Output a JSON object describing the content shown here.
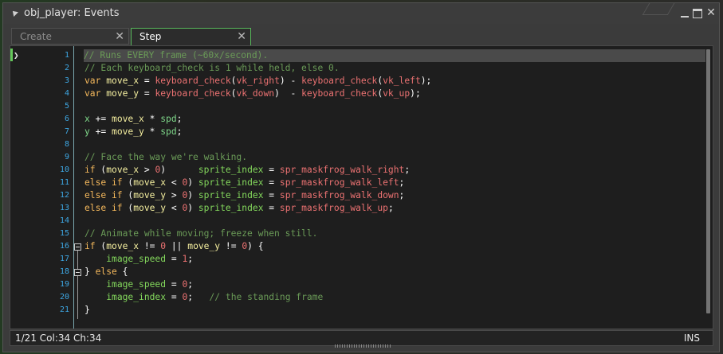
{
  "window": {
    "title": "obj_player: Events"
  },
  "tabs": [
    {
      "label": "Create",
      "active": false
    },
    {
      "label": "Step",
      "active": true
    }
  ],
  "status": {
    "position": "1/21 Col:34 Ch:34",
    "mode": "INS"
  },
  "editor": {
    "line_numbers": [
      "1",
      "2",
      "3",
      "4",
      "5",
      "6",
      "7",
      "8",
      "9",
      "10",
      "11",
      "12",
      "13",
      "14",
      "15",
      "16",
      "17",
      "18",
      "19",
      "20",
      "21"
    ],
    "lines": [
      [
        [
          "c",
          "// Runs EVERY frame (~60x/second)."
        ]
      ],
      [
        [
          "c",
          "// Each keyboard_check is 1 while held, else 0."
        ]
      ],
      [
        [
          "k",
          "var "
        ],
        [
          "v",
          "move_x"
        ],
        [
          "p",
          " = "
        ],
        [
          "f",
          "keyboard_check"
        ],
        [
          "p",
          "("
        ],
        [
          "r",
          "vk_right"
        ],
        [
          "p",
          ") - "
        ],
        [
          "f",
          "keyboard_check"
        ],
        [
          "p",
          "("
        ],
        [
          "r",
          "vk_left"
        ],
        [
          "p",
          ");"
        ]
      ],
      [
        [
          "k",
          "var "
        ],
        [
          "v",
          "move_y"
        ],
        [
          "p",
          " = "
        ],
        [
          "f",
          "keyboard_check"
        ],
        [
          "p",
          "("
        ],
        [
          "r",
          "vk_down"
        ],
        [
          "p",
          ")  - "
        ],
        [
          "f",
          "keyboard_check"
        ],
        [
          "p",
          "("
        ],
        [
          "r",
          "vk_up"
        ],
        [
          "p",
          ");"
        ]
      ],
      [],
      [
        [
          "b",
          "x"
        ],
        [
          "p",
          " += "
        ],
        [
          "v",
          "move_x"
        ],
        [
          "p",
          " * "
        ],
        [
          "b",
          "spd"
        ],
        [
          "p",
          ";"
        ]
      ],
      [
        [
          "b",
          "y"
        ],
        [
          "p",
          " += "
        ],
        [
          "v",
          "move_y"
        ],
        [
          "p",
          " * "
        ],
        [
          "b",
          "spd"
        ],
        [
          "p",
          ";"
        ]
      ],
      [],
      [
        [
          "c",
          "// Face the way we're walking."
        ]
      ],
      [
        [
          "k",
          "if "
        ],
        [
          "p",
          "("
        ],
        [
          "v",
          "move_x"
        ],
        [
          "p",
          " > "
        ],
        [
          "n",
          "0"
        ],
        [
          "p",
          ")      "
        ],
        [
          "g",
          "sprite_index"
        ],
        [
          "p",
          " = "
        ],
        [
          "r",
          "spr_maskfrog_walk_right"
        ],
        [
          "p",
          ";"
        ]
      ],
      [
        [
          "k",
          "else if "
        ],
        [
          "p",
          "("
        ],
        [
          "v",
          "move_x"
        ],
        [
          "p",
          " < "
        ],
        [
          "n",
          "0"
        ],
        [
          "p",
          ") "
        ],
        [
          "g",
          "sprite_index"
        ],
        [
          "p",
          " = "
        ],
        [
          "r",
          "spr_maskfrog_walk_left"
        ],
        [
          "p",
          ";"
        ]
      ],
      [
        [
          "k",
          "else if "
        ],
        [
          "p",
          "("
        ],
        [
          "v",
          "move_y"
        ],
        [
          "p",
          " > "
        ],
        [
          "n",
          "0"
        ],
        [
          "p",
          ") "
        ],
        [
          "g",
          "sprite_index"
        ],
        [
          "p",
          " = "
        ],
        [
          "r",
          "spr_maskfrog_walk_down"
        ],
        [
          "p",
          ";"
        ]
      ],
      [
        [
          "k",
          "else if "
        ],
        [
          "p",
          "("
        ],
        [
          "v",
          "move_y"
        ],
        [
          "p",
          " < "
        ],
        [
          "n",
          "0"
        ],
        [
          "p",
          ") "
        ],
        [
          "g",
          "sprite_index"
        ],
        [
          "p",
          " = "
        ],
        [
          "r",
          "spr_maskfrog_walk_up"
        ],
        [
          "p",
          ";"
        ]
      ],
      [],
      [
        [
          "c",
          "// Animate while moving; freeze when still."
        ]
      ],
      [
        [
          "k",
          "if "
        ],
        [
          "p",
          "("
        ],
        [
          "v",
          "move_x"
        ],
        [
          "p",
          " != "
        ],
        [
          "n",
          "0"
        ],
        [
          "p",
          " || "
        ],
        [
          "v",
          "move_y"
        ],
        [
          "p",
          " != "
        ],
        [
          "n",
          "0"
        ],
        [
          "p",
          ") {"
        ]
      ],
      [
        [
          "p",
          "    "
        ],
        [
          "g",
          "image_speed"
        ],
        [
          "p",
          " = "
        ],
        [
          "n",
          "1"
        ],
        [
          "p",
          ";"
        ]
      ],
      [
        [
          "p",
          "} "
        ],
        [
          "k",
          "else"
        ],
        [
          "p",
          " {"
        ]
      ],
      [
        [
          "p",
          "    "
        ],
        [
          "g",
          "image_speed"
        ],
        [
          "p",
          " = "
        ],
        [
          "n",
          "0"
        ],
        [
          "p",
          ";"
        ]
      ],
      [
        [
          "p",
          "    "
        ],
        [
          "g",
          "image_index"
        ],
        [
          "p",
          " = "
        ],
        [
          "n",
          "0"
        ],
        [
          "p",
          ";   "
        ],
        [
          "c",
          "// the standing frame"
        ]
      ],
      [
        [
          "p",
          "}"
        ]
      ]
    ]
  }
}
